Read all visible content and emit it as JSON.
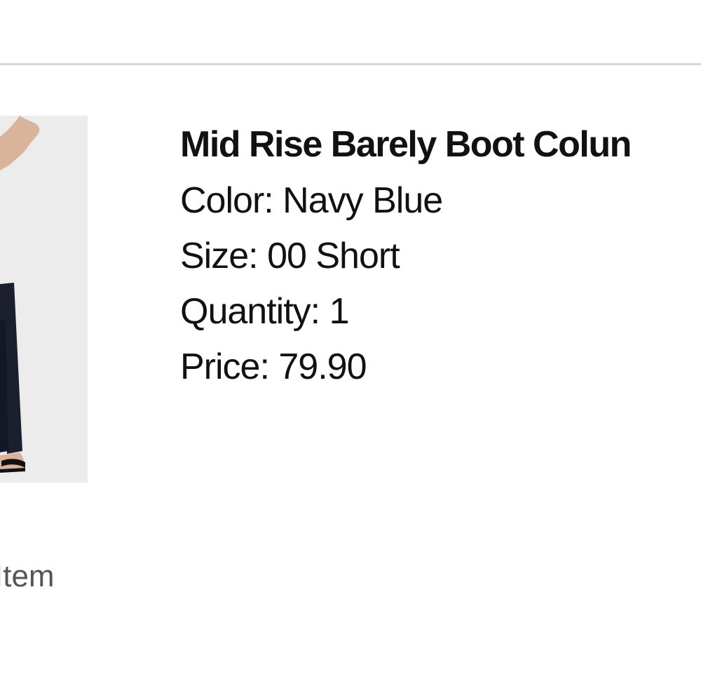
{
  "product": {
    "title": "Mid Rise Barely Boot Colun",
    "details": [
      {
        "label": "Color",
        "value": "Navy Blue"
      },
      {
        "label": "Size",
        "value": "00 Short"
      },
      {
        "label": "Quantity",
        "value": "1"
      },
      {
        "label": "Price",
        "value": "79.90"
      }
    ]
  },
  "actions": {
    "remove_label": "Item"
  },
  "colors": {
    "divider": "#d6d6d6",
    "image_background": "#ececec",
    "pants": "#1b1f2e",
    "link": "#555555"
  }
}
